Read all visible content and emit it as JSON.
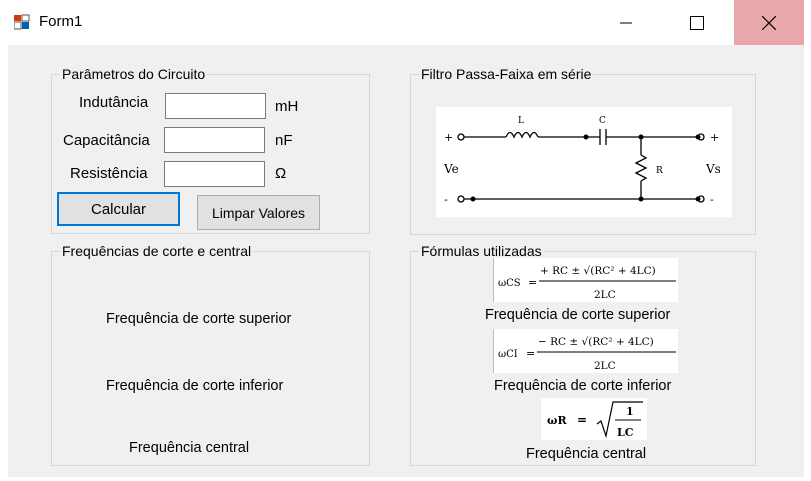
{
  "window": {
    "title": "Form1"
  },
  "params": {
    "group_title": "Parâmetros do Circuito",
    "inductance_label": "Indutância",
    "inductance_unit": "mH",
    "inductance_value": "",
    "capacitance_label": "Capacitância",
    "capacitance_unit": "nF",
    "capacitance_value": "",
    "resistance_label": "Resistência",
    "resistance_unit": "Ω",
    "resistance_value": "",
    "calc_button": "Calcular",
    "clear_button": "Limpar Valores"
  },
  "filter": {
    "group_title": "Filtro Passa-Faixa em série",
    "labels": {
      "L": "L",
      "C": "C",
      "R": "R",
      "Ve": "Ve",
      "Vs": "Vs",
      "plus": "+",
      "minus": "-"
    }
  },
  "freqs": {
    "group_title": "Frequências de corte e central",
    "upper": "Frequência de corte superior",
    "lower": "Frequência de corte inferior",
    "central": "Frequência central"
  },
  "formulas": {
    "group_title": "Fórmulas utilizadas",
    "f1_lhs": "ωCS",
    "f1_num": "+ RC ± √(RC² + 4LC)",
    "f1_den": "2LC",
    "f1_caption": "Frequência de corte superior",
    "f2_lhs": "ωCI",
    "f2_num": "− RC ± √(RC² + 4LC)",
    "f2_den": "2LC",
    "f2_caption": "Frequência de corte inferior",
    "f3_lhs": "ωR",
    "f3_num": "1",
    "f3_den": "LC",
    "f3_caption": "Frequência central"
  }
}
